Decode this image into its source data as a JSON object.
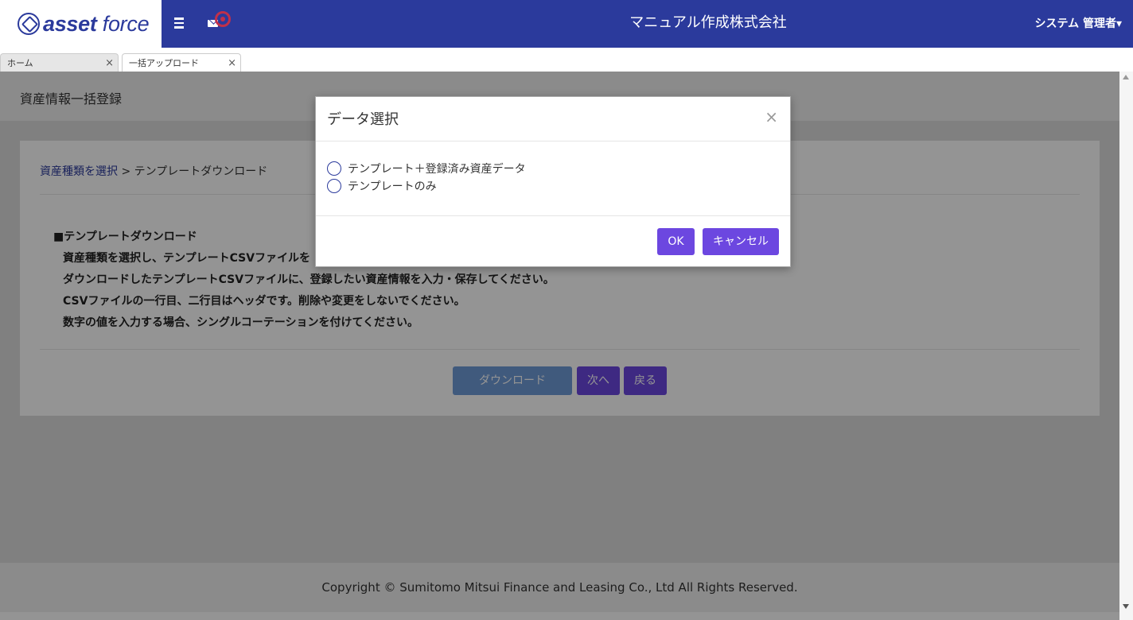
{
  "header": {
    "logo_word1": "asset",
    "logo_word2": "force",
    "company": "マニュアル作成株式会社",
    "user": "システム 管理者",
    "user_caret": "▾"
  },
  "tabs": [
    {
      "label": "ホーム"
    },
    {
      "label": "一括アップロード"
    }
  ],
  "tab_close": "×",
  "page": {
    "title": "資産情報一括登録",
    "breadcrumb_link": "資産種類を選択",
    "breadcrumb_sep": " > ",
    "breadcrumb_current": "テンプレートダウンロード",
    "instructions_heading": "■テンプレートダウンロード",
    "instructions": [
      "資産種類を選択し、テンプレートCSVファイルを",
      "ダウンロードしたテンプレートCSVファイルに、登録したい資産情報を入力・保存してください。",
      "CSVファイルの一行目、二行目はヘッダです。削除や変更をしないでください。",
      "数字の値を入力する場合、シングルコーテーションを付けてください。"
    ],
    "download_label": "ダウンロード",
    "next_label": "次へ",
    "back_label": "戻る"
  },
  "footer": {
    "copyright": "Copyright © Sumitomo Mitsui Finance and Leasing Co., Ltd All Rights Reserved."
  },
  "modal": {
    "title": "データ選択",
    "close": "×",
    "options": [
      "テンプレート＋登録済み資産データ",
      "テンプレートのみ"
    ],
    "ok_label": "OK",
    "cancel_label": "キャンセル"
  },
  "colors": {
    "header_bg": "#2b3a9c",
    "primary_button": "#6c47e0",
    "download_button": "#6f9bd8",
    "badge": "#c0304a"
  }
}
